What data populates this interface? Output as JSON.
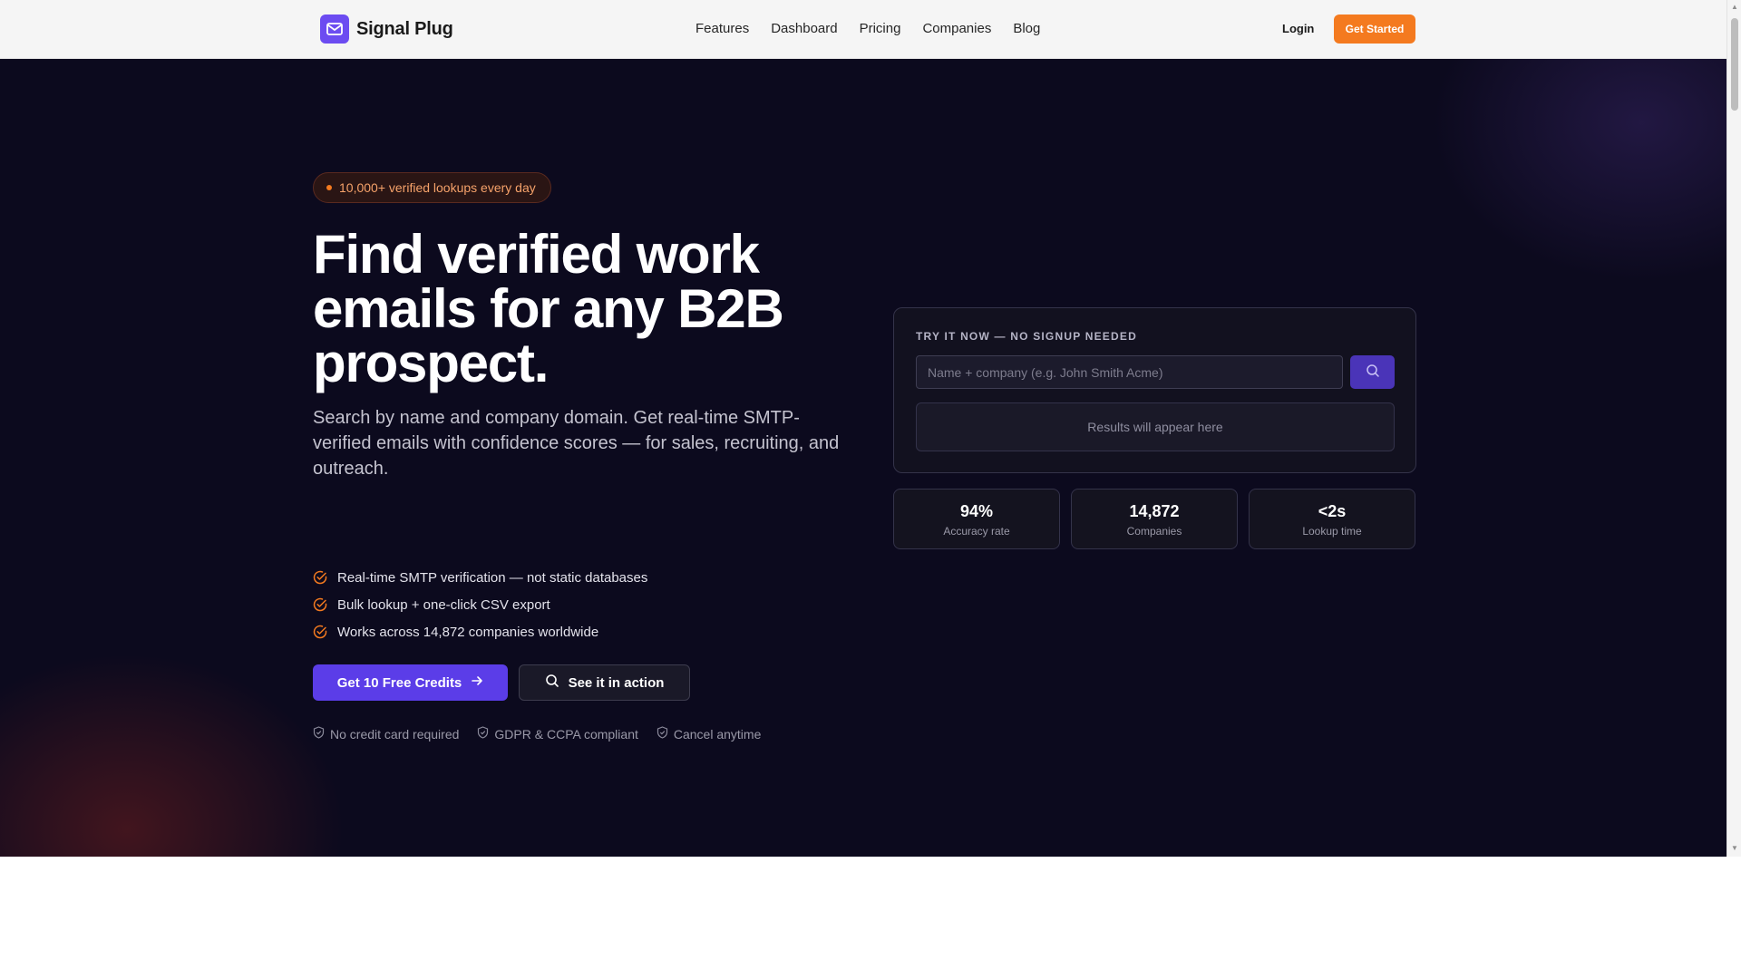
{
  "nav": {
    "brand": "Signal Plug",
    "links": [
      "Features",
      "Dashboard",
      "Pricing",
      "Companies",
      "Blog"
    ],
    "login": "Login",
    "cta": "Get Started"
  },
  "hero": {
    "badge": "10,000+ verified lookups every day",
    "headline": "Find verified work emails for any B2B prospect.",
    "subhead": "Search by name and company domain. Get real-time SMTP-verified emails with confidence scores — for sales, recruiting, and outreach.",
    "features": [
      "Real-time SMTP verification — not static databases",
      "Bulk lookup + one-click CSV export",
      "Works across 14,872 companies worldwide"
    ],
    "primary_cta": "Get 10 Free Credits",
    "secondary_cta": "See it in action",
    "trust": [
      "No credit card required",
      "GDPR & CCPA compliant",
      "Cancel anytime"
    ]
  },
  "try_it": {
    "label": "TRY IT NOW — NO SIGNUP NEEDED",
    "placeholder": "Name + company (e.g. John Smith Acme)",
    "results_placeholder": "Results will appear here"
  },
  "stats": [
    {
      "value": "94%",
      "label": "Accuracy rate"
    },
    {
      "value": "14,872",
      "label": "Companies"
    },
    {
      "value": "<2s",
      "label": "Lookup time"
    }
  ],
  "colors": {
    "brand": "#6c4cf1",
    "accent_orange": "#f47a1f",
    "hero_bg": "#0c0a1e",
    "primary_button": "#5b3de8"
  },
  "icons": {
    "brand": "mail-icon",
    "feature": "check-circle-icon",
    "trust": "shield-icon",
    "search": "search-icon",
    "arrow": "arrow-right-icon"
  }
}
